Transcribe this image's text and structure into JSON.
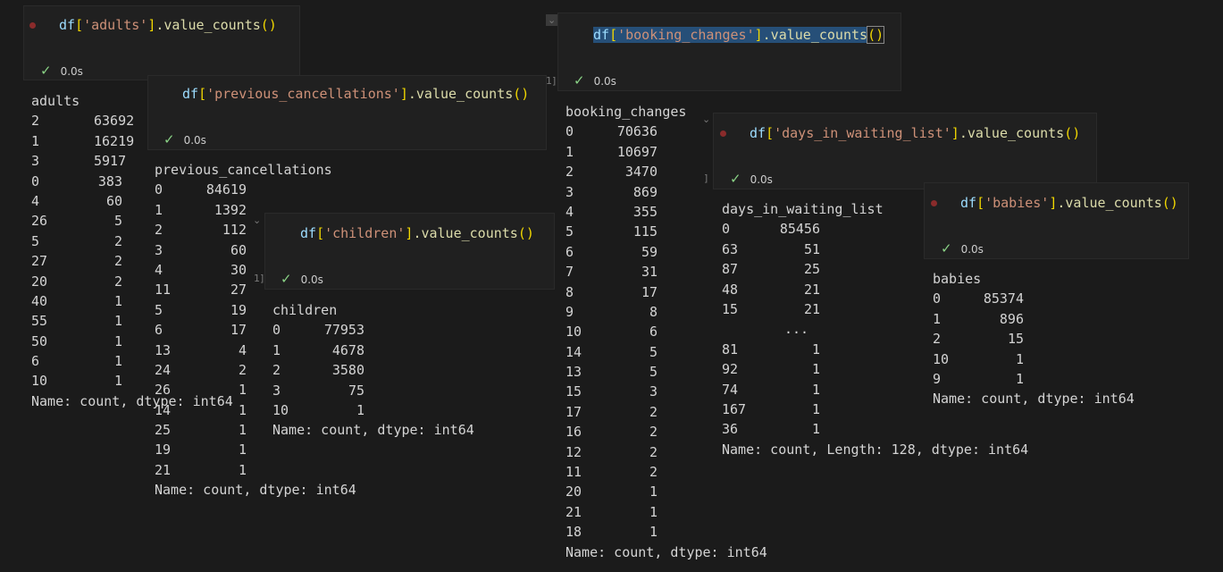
{
  "exec_time": "0.0s",
  "cells": {
    "adults": {
      "code": {
        "df": "df",
        "key": "'adults'",
        "method": ".value_counts"
      },
      "output": {
        "header": "adults",
        "rows": [
          [
            "2",
            "63692"
          ],
          [
            "1",
            "16219"
          ],
          [
            "3",
            "5917"
          ],
          [
            "0",
            "383"
          ],
          [
            "4",
            "60"
          ],
          [
            "26",
            "5"
          ],
          [
            "5",
            "2"
          ],
          [
            "27",
            "2"
          ],
          [
            "20",
            "2"
          ],
          [
            "40",
            "1"
          ],
          [
            "55",
            "1"
          ],
          [
            "50",
            "1"
          ],
          [
            "6",
            "1"
          ],
          [
            "10",
            "1"
          ]
        ],
        "footer": "Name: count, dtype: int64"
      }
    },
    "previous_cancellations": {
      "code": {
        "df": "df",
        "key": "'previous_cancellations'",
        "method": ".value_counts"
      },
      "output": {
        "header": "previous_cancellations",
        "rows": [
          [
            "0",
            "84619"
          ],
          [
            "1",
            "1392"
          ],
          [
            "2",
            "112"
          ],
          [
            "3",
            "60"
          ],
          [
            "4",
            "30"
          ],
          [
            "11",
            "27"
          ],
          [
            "5",
            "19"
          ],
          [
            "6",
            "17"
          ],
          [
            "13",
            "4"
          ],
          [
            "24",
            "2"
          ],
          [
            "26",
            "1"
          ],
          [
            "14",
            "1"
          ],
          [
            "25",
            "1"
          ],
          [
            "19",
            "1"
          ],
          [
            "21",
            "1"
          ]
        ],
        "footer": "Name: count, dtype: int64"
      }
    },
    "children": {
      "code": {
        "df": "df",
        "key": "'children'",
        "method": ".value_counts"
      },
      "output": {
        "header": "children",
        "rows": [
          [
            "0",
            "77953"
          ],
          [
            "1",
            "4678"
          ],
          [
            "2",
            "3580"
          ],
          [
            "3",
            "75"
          ],
          [
            "10",
            "1"
          ]
        ],
        "footer": "Name: count, dtype: int64"
      }
    },
    "booking_changes": {
      "code": {
        "df": "df",
        "key": "'booking_changes'",
        "method": ".value_counts"
      },
      "output": {
        "header": "booking_changes",
        "rows": [
          [
            "0",
            "70636"
          ],
          [
            "1",
            "10697"
          ],
          [
            "2",
            "3470"
          ],
          [
            "3",
            "869"
          ],
          [
            "4",
            "355"
          ],
          [
            "5",
            "115"
          ],
          [
            "6",
            "59"
          ],
          [
            "7",
            "31"
          ],
          [
            "8",
            "17"
          ],
          [
            "9",
            "8"
          ],
          [
            "10",
            "6"
          ],
          [
            "14",
            "5"
          ],
          [
            "13",
            "5"
          ],
          [
            "15",
            "3"
          ],
          [
            "17",
            "2"
          ],
          [
            "16",
            "2"
          ],
          [
            "12",
            "2"
          ],
          [
            "11",
            "2"
          ],
          [
            "20",
            "1"
          ],
          [
            "21",
            "1"
          ],
          [
            "18",
            "1"
          ]
        ],
        "footer": "Name: count, dtype: int64"
      }
    },
    "days_in_waiting_list": {
      "code": {
        "df": "df",
        "key": "'days_in_waiting_list'",
        "method": ".value_counts"
      },
      "output": {
        "header": "days_in_waiting_list",
        "rows": [
          [
            "0",
            "85456"
          ],
          [
            "63",
            "51"
          ],
          [
            "87",
            "25"
          ],
          [
            "48",
            "21"
          ],
          [
            "15",
            "21"
          ],
          [
            "...",
            ""
          ],
          [
            "81",
            "1"
          ],
          [
            "92",
            "1"
          ],
          [
            "74",
            "1"
          ],
          [
            "167",
            "1"
          ],
          [
            "36",
            "1"
          ]
        ],
        "footer": "Name: count, Length: 128, dtype: int64"
      }
    },
    "babies": {
      "code": {
        "df": "df",
        "key": "'babies'",
        "method": ".value_counts"
      },
      "output": {
        "header": "babies",
        "rows": [
          [
            "0",
            "85374"
          ],
          [
            "1",
            "896"
          ],
          [
            "2",
            "15"
          ],
          [
            "10",
            "1"
          ],
          [
            "9",
            "1"
          ]
        ],
        "footer": "Name: count, dtype: int64"
      }
    }
  }
}
